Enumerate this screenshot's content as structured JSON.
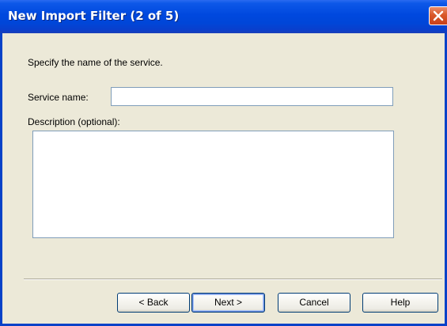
{
  "window": {
    "title": "New Import Filter (2 of 5)",
    "close_icon": "close-icon"
  },
  "content": {
    "instruction": "Specify the name of the service.",
    "service_name_label": "Service name:",
    "service_name_value": "",
    "description_label": "Description (optional):",
    "description_value": ""
  },
  "buttons": {
    "back": "< Back",
    "next": "Next >",
    "cancel": "Cancel",
    "help": "Help"
  },
  "colors": {
    "titlebar": "#0048de",
    "dialog_background": "#ece9d8",
    "close_button": "#d9582a"
  }
}
